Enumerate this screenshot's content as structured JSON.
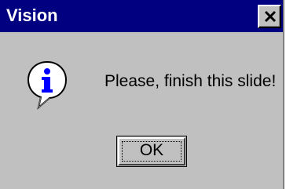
{
  "window": {
    "title": "Vision",
    "close_icon": "close-icon",
    "colors": {
      "titlebar": "#000080",
      "face": "#c0c0c0"
    }
  },
  "dialog": {
    "icon": "information-icon",
    "message": "Please, finish this slide!",
    "ok_label": "OK"
  }
}
